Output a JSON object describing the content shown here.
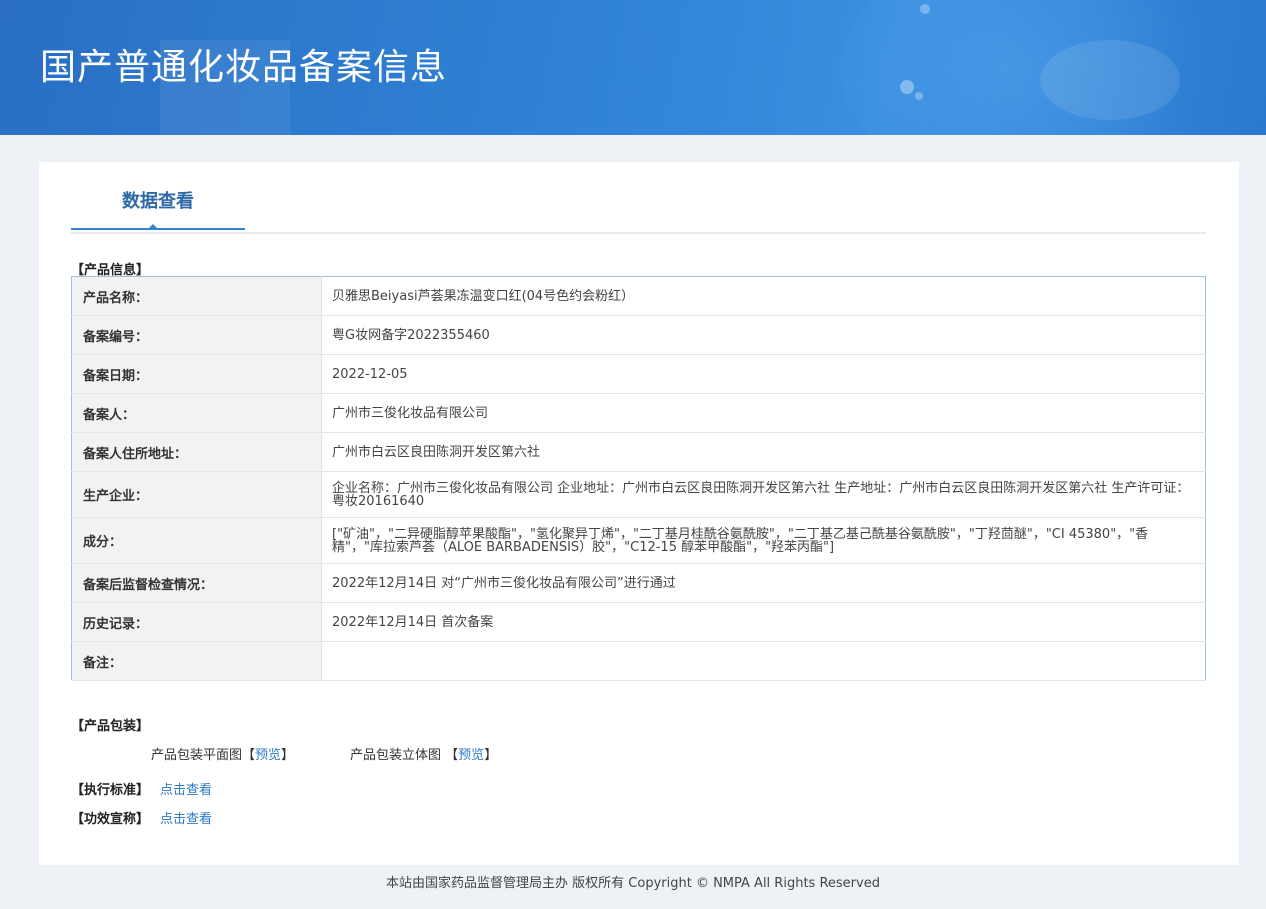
{
  "header": {
    "title": "国产普通化妆品备案信息"
  },
  "tab": {
    "label": "数据查看"
  },
  "sections": {
    "product_info": "【产品信息】",
    "packaging": "【产品包装】",
    "standard": "【执行标准】",
    "efficacy": "【功效宣称】"
  },
  "product_info": {
    "rows": [
      {
        "key": "产品名称：",
        "value": "贝雅思Beiyasi芦荟果冻温变口红(04号色约会粉红）"
      },
      {
        "key": "备案编号：",
        "value": "粤G妆网备字2022355460"
      },
      {
        "key": "备案日期：",
        "value": "2022-12-05"
      },
      {
        "key": "备案人：",
        "value": "广州市三俊化妆品有限公司"
      },
      {
        "key": "备案人住所地址：",
        "value": "广州市白云区良田陈洞开发区第六社"
      },
      {
        "key": "生产企业：",
        "value": "企业名称：广州市三俊化妆品有限公司 企业地址：广州市白云区良田陈洞开发区第六社 生产地址：广州市白云区良田陈洞开发区第六社 生产许可证：粤妆20161640"
      },
      {
        "key": "成分：",
        "value": "[\"矿油\"，\"二异硬脂醇苹果酸酯\"，\"氢化聚异丁烯\"，\"二丁基月桂酰谷氨酰胺\"，\"二丁基乙基己酰基谷氨酰胺\"，\"丁羟茴醚\"，\"CI 45380\"，\"香精\"，\"库拉索芦荟（ALOE BARBADENSIS）胶\"，\"C12-15 醇苯甲酸酯\"，\"羟苯丙酯\"]"
      },
      {
        "key": "备案后监督检查情况：",
        "value": "2022年12月14日 对“广州市三俊化妆品有限公司”进行通过"
      },
      {
        "key": "历史记录：",
        "value": "2022年12月14日 首次备案"
      },
      {
        "key": "备注：",
        "value": ""
      }
    ]
  },
  "packaging": {
    "flat_label": "产品包装平面图",
    "solid_label": "产品包装立体图",
    "bracket_open": "【",
    "bracket_close": "】",
    "preview_link": "预览"
  },
  "links": {
    "view": "点击查看"
  },
  "footer": {
    "text": "本站由国家药品监督管理局主办 版权所有 Copyright © NMPA All Rights Reserved"
  },
  "colors": {
    "banner": "#2f82d6",
    "accent": "#2e7bc7",
    "tab_text": "#2e6aa8"
  }
}
